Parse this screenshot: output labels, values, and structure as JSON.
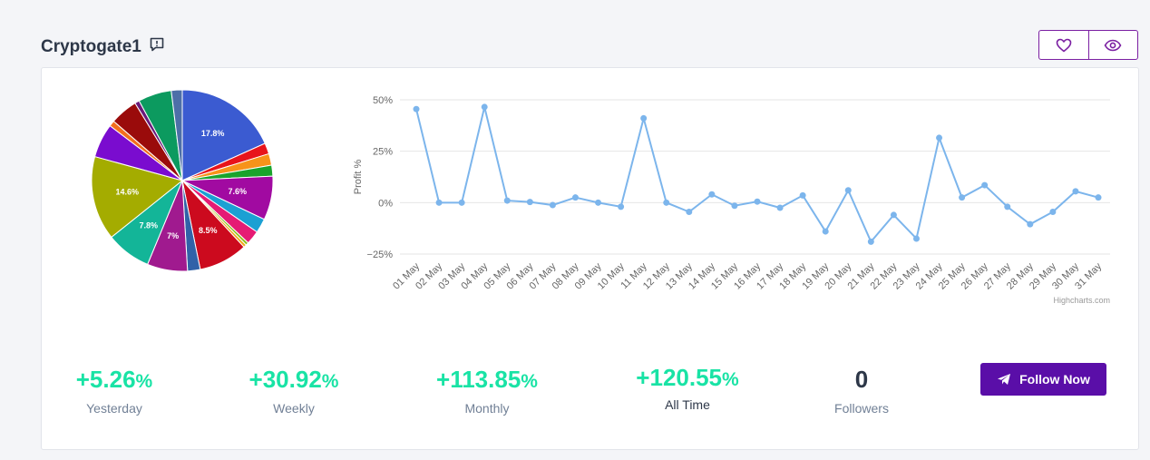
{
  "header": {
    "title": "Cryptogate1",
    "report_icon": "message-alert-icon",
    "like_icon": "heart-icon",
    "watch_icon": "eye-icon"
  },
  "pie": {
    "slices": [
      {
        "value": 17.8,
        "label": "17.8%",
        "color": "#3b5bd1"
      },
      {
        "value": 1.9,
        "label": "",
        "color": "#e8141b"
      },
      {
        "value": 2.0,
        "label": "",
        "color": "#f7931a"
      },
      {
        "value": 1.9,
        "label": "",
        "color": "#1aa32c"
      },
      {
        "value": 7.6,
        "label": "7.6%",
        "color": "#a10aa1"
      },
      {
        "value": 2.5,
        "label": "",
        "color": "#1ba0d3"
      },
      {
        "value": 2.4,
        "label": "",
        "color": "#e51b74"
      },
      {
        "value": 0.5,
        "label": "",
        "color": "#8dc21f"
      },
      {
        "value": 0.5,
        "label": "",
        "color": "#f2a71b"
      },
      {
        "value": 8.5,
        "label": "8.5%",
        "color": "#cc0a1e"
      },
      {
        "value": 2.2,
        "label": "",
        "color": "#3162a8"
      },
      {
        "value": 7.0,
        "label": "7%",
        "color": "#a01a8f"
      },
      {
        "value": 7.8,
        "label": "7.8%",
        "color": "#13b598"
      },
      {
        "value": 14.6,
        "label": "14.6%",
        "color": "#a4ac00"
      },
      {
        "value": 5.9,
        "label": "",
        "color": "#7a0ccf"
      },
      {
        "value": 1.0,
        "label": "",
        "color": "#f36f1f"
      },
      {
        "value": 4.8,
        "label": "",
        "color": "#9a0b0b"
      },
      {
        "value": 0.8,
        "label": "",
        "color": "#6a1a7a"
      },
      {
        "value": 5.8,
        "label": "",
        "color": "#0c9a5f"
      },
      {
        "value": 1.9,
        "label": "",
        "color": "#4d6fa8"
      }
    ]
  },
  "chart_data": {
    "type": "line",
    "ylabel": "Profit %",
    "ylim": [
      -25,
      50
    ],
    "yticks": [
      "50%",
      "25%",
      "0%",
      "−25%"
    ],
    "x": [
      "01 May",
      "02 May",
      "03 May",
      "04 May",
      "05 May",
      "06 May",
      "07 May",
      "08 May",
      "09 May",
      "10 May",
      "11 May",
      "12 May",
      "13 May",
      "14 May",
      "15 May",
      "16 May",
      "17 May",
      "18 May",
      "19 May",
      "20 May",
      "21 May",
      "22 May",
      "23 May",
      "24 May",
      "25 May",
      "26 May",
      "27 May",
      "28 May",
      "29 May",
      "30 May",
      "31 May"
    ],
    "series": [
      {
        "values": [
          45.5,
          0,
          0,
          46.5,
          1,
          0.3,
          -1.2,
          2.5,
          0,
          -2,
          41,
          0,
          -4.5,
          4,
          -1.5,
          0.5,
          -2.5,
          3.5,
          -14,
          6,
          -19,
          -6,
          -17.5,
          31.5,
          2.5,
          8.5,
          -2,
          -10.5,
          -4.5,
          5.5,
          2.5
        ],
        "color": "#7cb5ec"
      }
    ],
    "credit": "Highcharts.com"
  },
  "stats": [
    {
      "value": "+5.26",
      "pct": "%",
      "label": "Yesterday"
    },
    {
      "value": "+30.92",
      "pct": "%",
      "label": "Weekly"
    },
    {
      "value": "+113.85",
      "pct": "%",
      "label": "Monthly"
    },
    {
      "value": "+120.55",
      "pct": "%",
      "label": "All Time"
    },
    {
      "value": "0",
      "pct": "",
      "label": "Followers"
    }
  ],
  "follow_button": {
    "label": "Follow Now",
    "icon": "paper-plane-icon"
  }
}
